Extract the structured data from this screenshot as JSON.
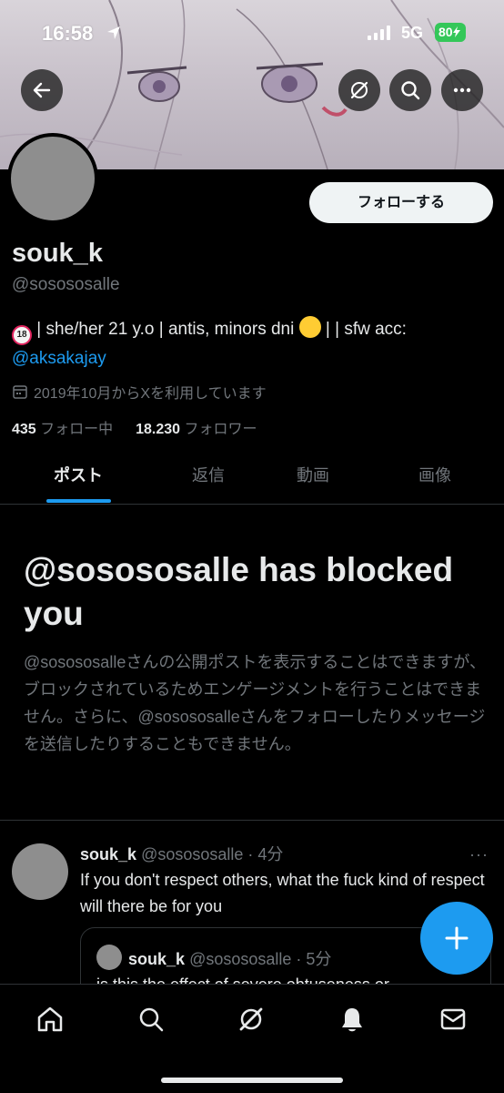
{
  "status_bar": {
    "time": "16:58",
    "network": "5G",
    "battery": "80"
  },
  "header": {
    "icons": [
      "back-arrow-icon",
      "grok-icon",
      "search-icon",
      "more-icon"
    ]
  },
  "profile": {
    "follow_label": "フォローする",
    "display_name": "souk_k",
    "handle": "@sosososalle",
    "bio_badge": "18",
    "bio_part1": "| she/her 21 y.o | antis, minors dni",
    "bio_part2": "| | sfw acc:",
    "bio_link": "@aksakajay",
    "joined": "2019年10月からXを利用しています",
    "following_count": "435",
    "following_label": "フォロー中",
    "followers_count": "18.230",
    "followers_label": "フォロワー"
  },
  "tabs": [
    {
      "label": "ポスト",
      "active": true
    },
    {
      "label": "返信",
      "active": false
    },
    {
      "label": "動画",
      "active": false
    },
    {
      "label": "画像",
      "active": false
    }
  ],
  "blocked": {
    "title": "@sosososalle has blocked you",
    "description": "@sosososalleさんの公開ポストを表示することはできますが、ブロックされているためエンゲージメントを行うことはできません。さらに、@sosososalleさんをフォローしたりメッセージを送信したりすることもできません。"
  },
  "post": {
    "name": "souk_k",
    "meta": "@sosososalle · 4分",
    "more": "···",
    "text": "If you don't respect others, what the fuck kind of respect will there be for you",
    "quote": {
      "name": "souk_k",
      "meta": "@sosososalle · 5分",
      "text": "is this the effect of severe obtuseness or"
    }
  },
  "bottom_nav": [
    "home-icon",
    "search-icon",
    "grok-icon",
    "notifications-icon",
    "messages-icon"
  ],
  "colors": {
    "accent": "#1d9bf0",
    "background": "#000000",
    "text_primary": "#e7e9ea",
    "text_secondary": "#71767b",
    "battery": "#34c759"
  }
}
